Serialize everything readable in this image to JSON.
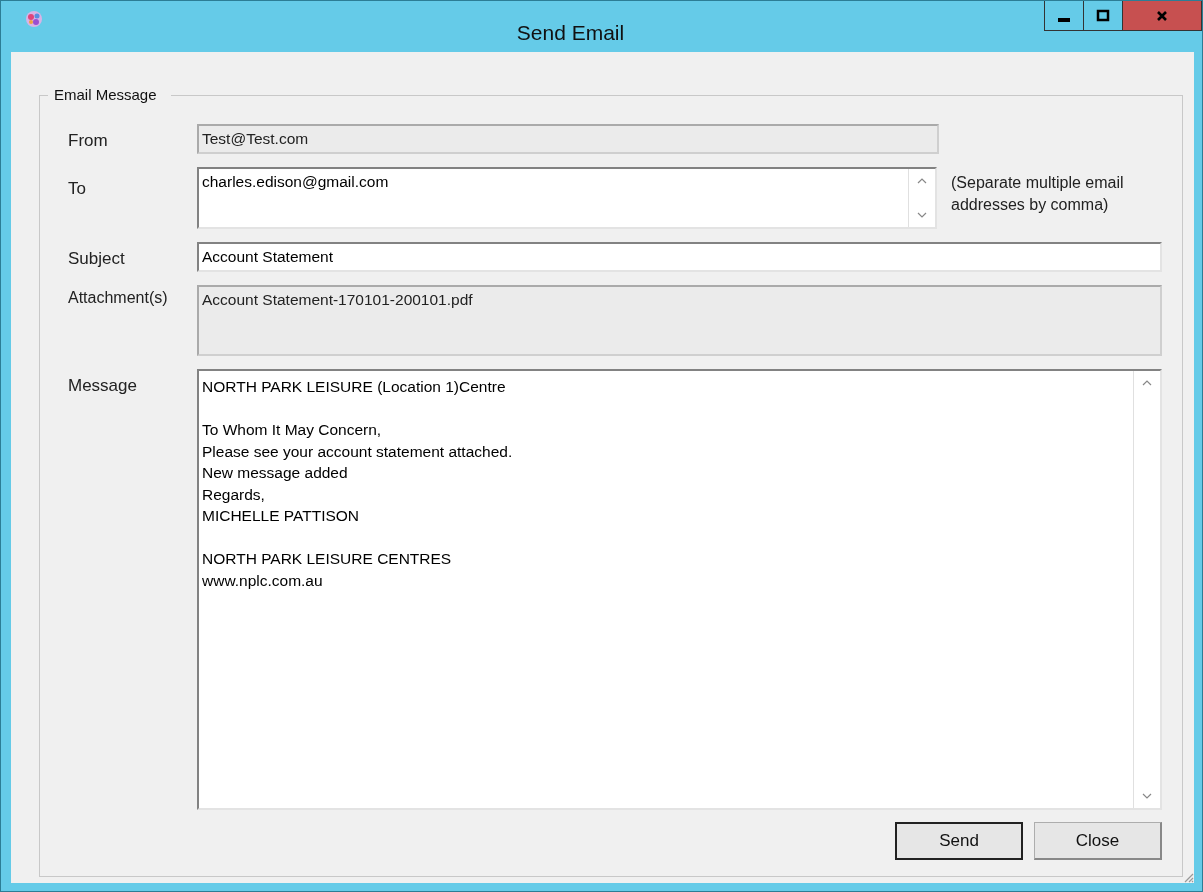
{
  "window": {
    "title": "Send Email",
    "controls": [
      {
        "kind": "minimize"
      },
      {
        "kind": "maximize"
      },
      {
        "kind": "close"
      }
    ]
  },
  "group": {
    "title": "Email Message"
  },
  "fields": [
    {
      "kind": "single",
      "label": "From",
      "value": "Test@Test.com",
      "disabled": true
    },
    {
      "kind": "scroll",
      "label": "To",
      "value": "charles.edison@gmail.com",
      "disabled": false,
      "note": "(Separate multiple email addresses by comma)"
    },
    {
      "kind": "single",
      "label": "Subject",
      "value": "Account Statement",
      "disabled": false
    },
    {
      "kind": "multi",
      "label": "Attachment(s)",
      "value": "Account Statement-170101-200101.pdf",
      "disabled": true
    },
    {
      "kind": "message",
      "label": "Message",
      "value": "NORTH PARK LEISURE (Location 1)Centre\n\nTo Whom It May Concern,\nPlease see your account statement attached.\nNew message added\nRegards,\nMICHELLE PATTISON\n\nNORTH PARK LEISURE CENTRES\nwww.nplc.com.au",
      "disabled": false
    }
  ],
  "buttons": [
    {
      "label": "Send",
      "default": true
    },
    {
      "label": "Close",
      "default": false
    }
  ]
}
